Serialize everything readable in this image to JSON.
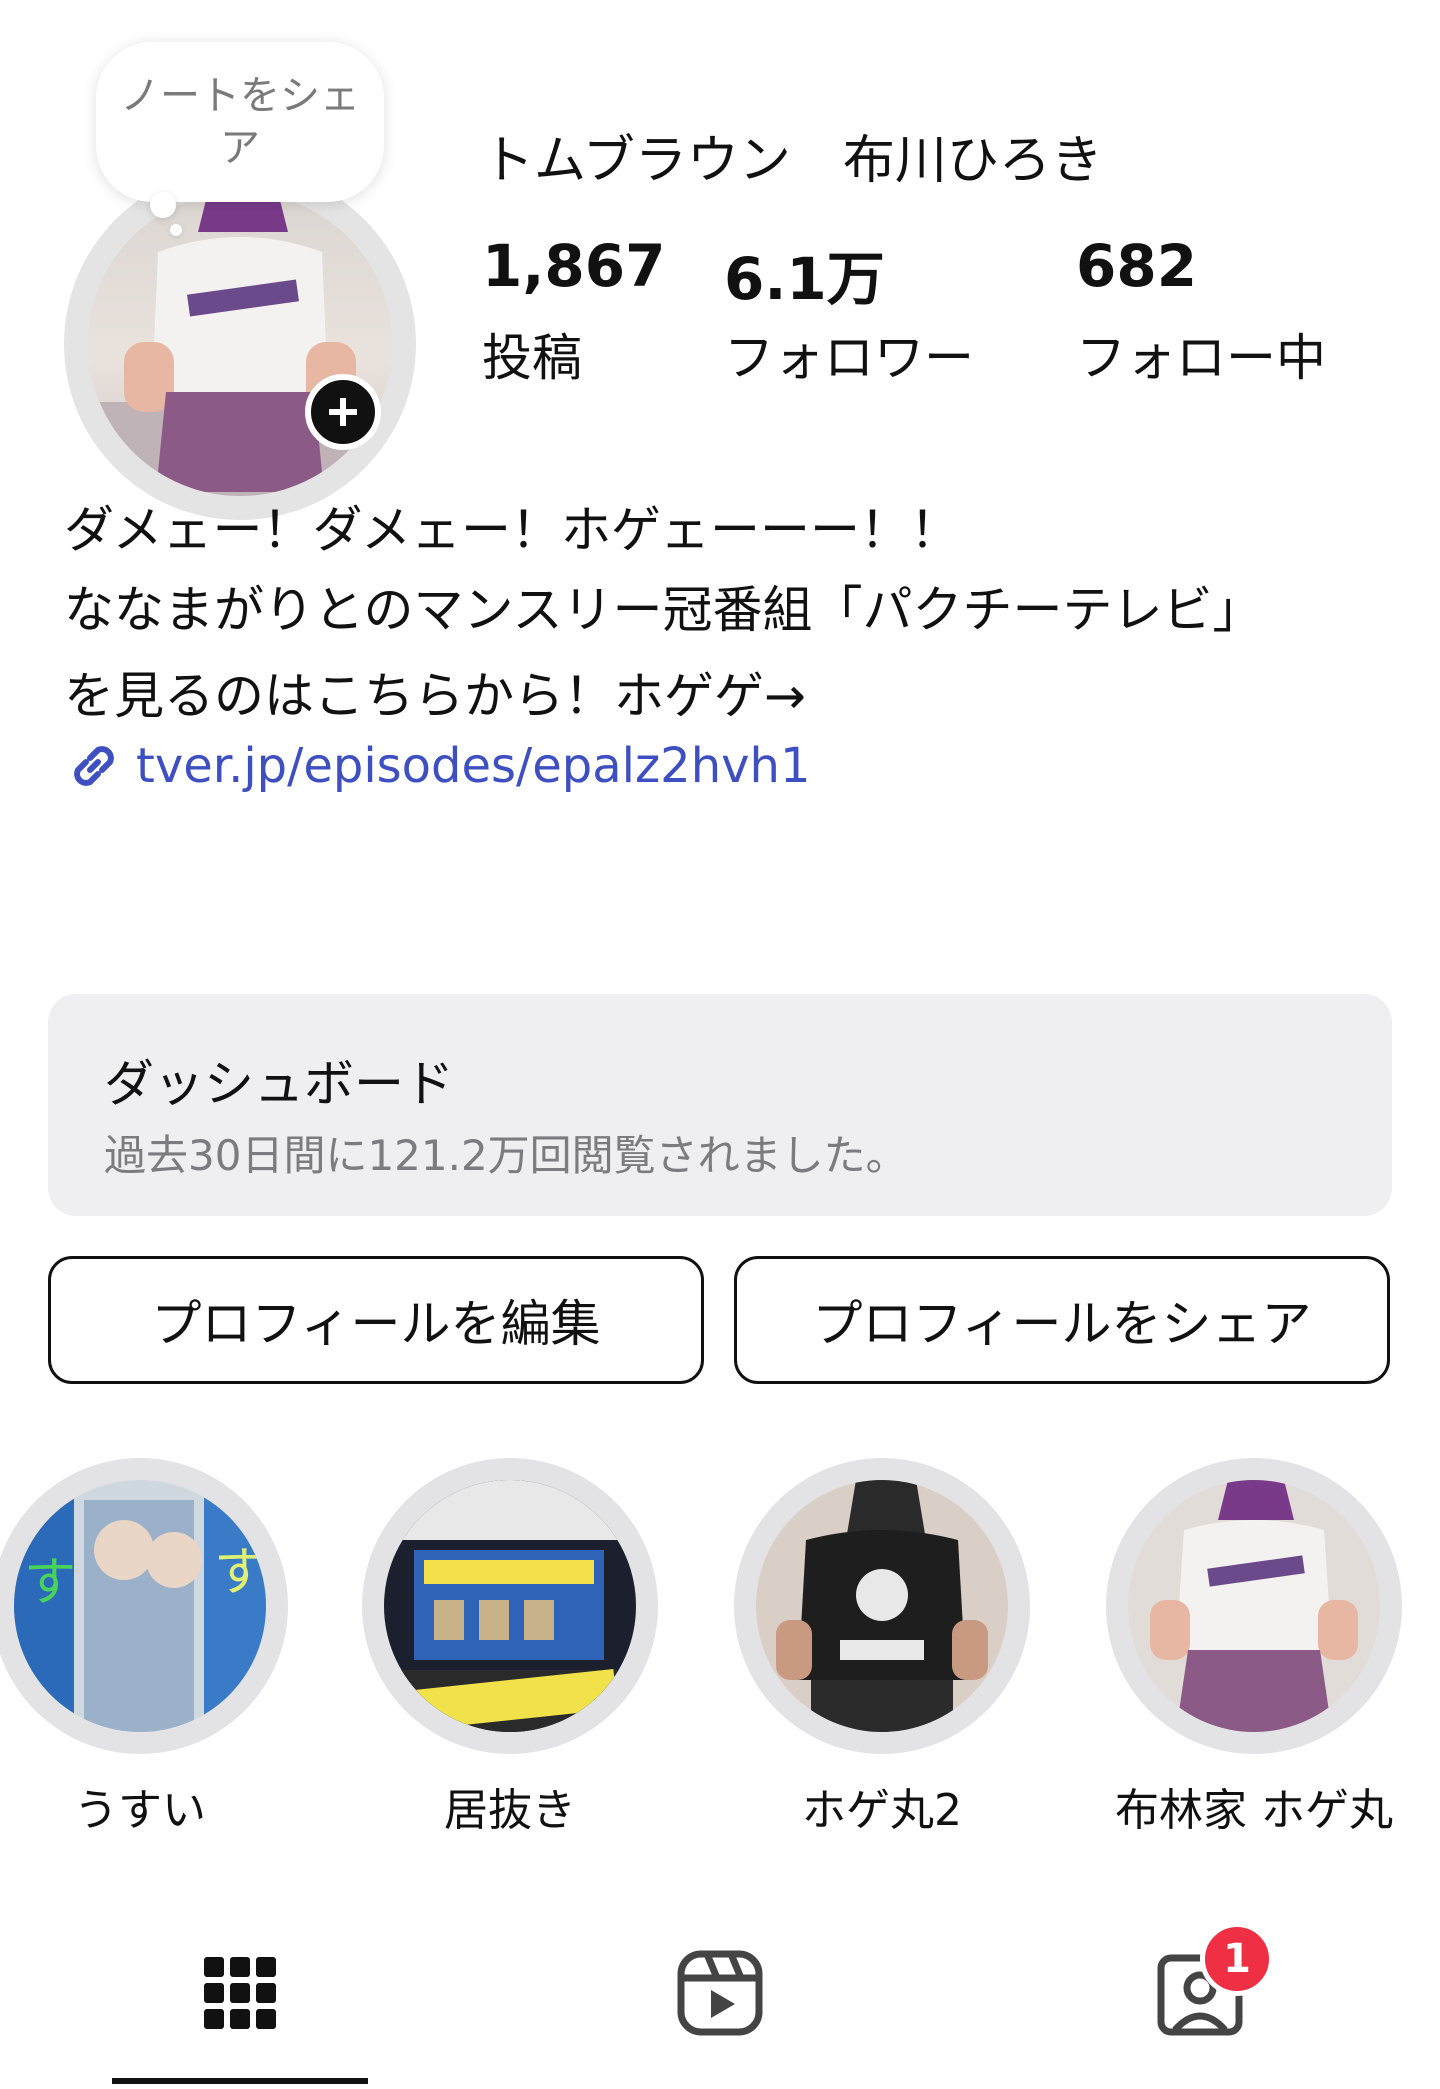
{
  "note": {
    "text": "ノートをシェア"
  },
  "profile": {
    "username": "トムブラウン　布川ひろき",
    "stats": [
      {
        "value": "1,867",
        "label": "投稿"
      },
      {
        "value": "6.1万",
        "label": "フォロワー"
      },
      {
        "value": "682",
        "label": "フォロー中"
      }
    ],
    "bio": [
      "ダメェー！ダメェー！ホゲェーーー！！",
      "ななまがりとのマンスリー冠番組「パクチーテレビ」",
      "を見るのはこちらから！ホゲゲ→"
    ],
    "link": "tver.jp/episodes/epalz2hvh1"
  },
  "dashboard": {
    "title": "ダッシュボード",
    "subtitle": "過去30日間に121.2万回閲覧されました。"
  },
  "buttons": {
    "edit": "プロフィールを編集",
    "share": "プロフィールをシェア"
  },
  "highlights": [
    {
      "label": "うすい"
    },
    {
      "label": "居抜き"
    },
    {
      "label": "ホゲ丸2"
    },
    {
      "label": "布林家 ホゲ丸"
    }
  ],
  "tabs": {
    "active": "grid",
    "tagged_badge": "1"
  },
  "colors": {
    "link": "#3e4fc2",
    "badge": "#ef2f43",
    "dashboard_bg": "#efeff2"
  }
}
